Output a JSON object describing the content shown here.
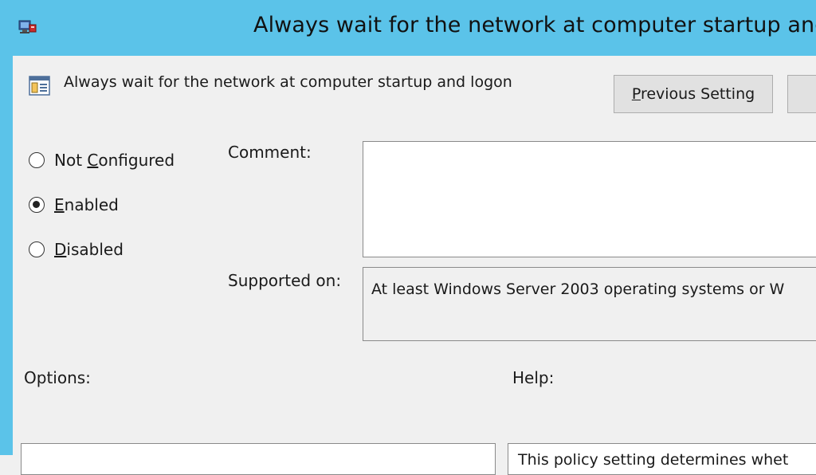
{
  "window": {
    "title": "Always wait for the network at computer startup and l"
  },
  "header": {
    "policy_name": "Always wait for the network at computer startup and logon",
    "previous_button": {
      "prefix": "P",
      "rest": "revious Setting"
    },
    "next_button": {
      "label": ""
    }
  },
  "state": {
    "options": [
      {
        "prefix": "Not ",
        "mnemonic": "C",
        "rest": "onfigured",
        "selected": false
      },
      {
        "prefix": "",
        "mnemonic": "E",
        "rest": "nabled",
        "selected": true
      },
      {
        "prefix": "",
        "mnemonic": "D",
        "rest": "isabled",
        "selected": false
      }
    ]
  },
  "comment": {
    "label": "Comment:",
    "value": ""
  },
  "supported": {
    "label": "Supported on:",
    "value": "At least Windows Server 2003 operating systems or W"
  },
  "options_panel": {
    "label": "Options:"
  },
  "help_panel": {
    "label": "Help:",
    "text": "This policy setting determines whet"
  },
  "colors": {
    "titlebar": "#5bc3e9",
    "background": "#f0f0f0"
  }
}
